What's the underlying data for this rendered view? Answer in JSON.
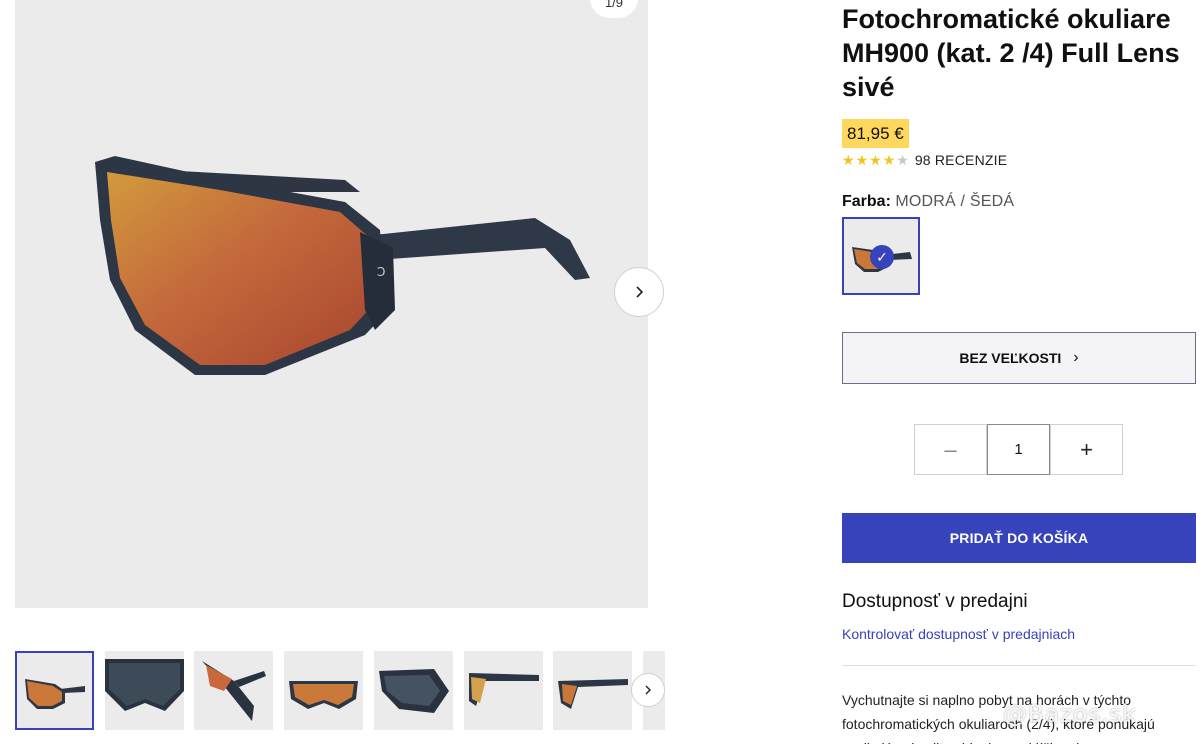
{
  "gallery": {
    "counter": "1/9",
    "next_icon": "chevron-right-icon",
    "thumbnails": [
      {
        "alt": "thumb-1"
      },
      {
        "alt": "thumb-2"
      },
      {
        "alt": "thumb-3"
      },
      {
        "alt": "thumb-4"
      },
      {
        "alt": "thumb-5"
      },
      {
        "alt": "thumb-6"
      },
      {
        "alt": "thumb-7"
      }
    ]
  },
  "product": {
    "title": "Fotochromatické okuliare MH900 (kat. 2 /4) Full Lens sivé",
    "price": "81,95 €",
    "rating": {
      "stars": 4.5,
      "reviews": "98 RECENZIE"
    },
    "color_label": "Farba:",
    "color_value": "MODRÁ / ŠEDÁ",
    "size_button": "BEZ VEĽKOSTI",
    "quantity": "1",
    "add_to_cart": "PRIDAŤ DO KOŠÍKA",
    "store_heading": "Dostupnosť v predajni",
    "store_link": "Kontrolovať dostupnosť v predajniach",
    "description": "Vychutnajte si naplno pobyt na horách v týchto fotochromatických okuliaroch (2/4), ktoré ponúkajú vynikajúcu kvalitu videnia so sklíčkami s"
  },
  "watermark": "@Bazos.sk",
  "colors": {
    "accent": "#3643ba",
    "price_bg": "#fdd85d",
    "star": "#f2c31f"
  }
}
